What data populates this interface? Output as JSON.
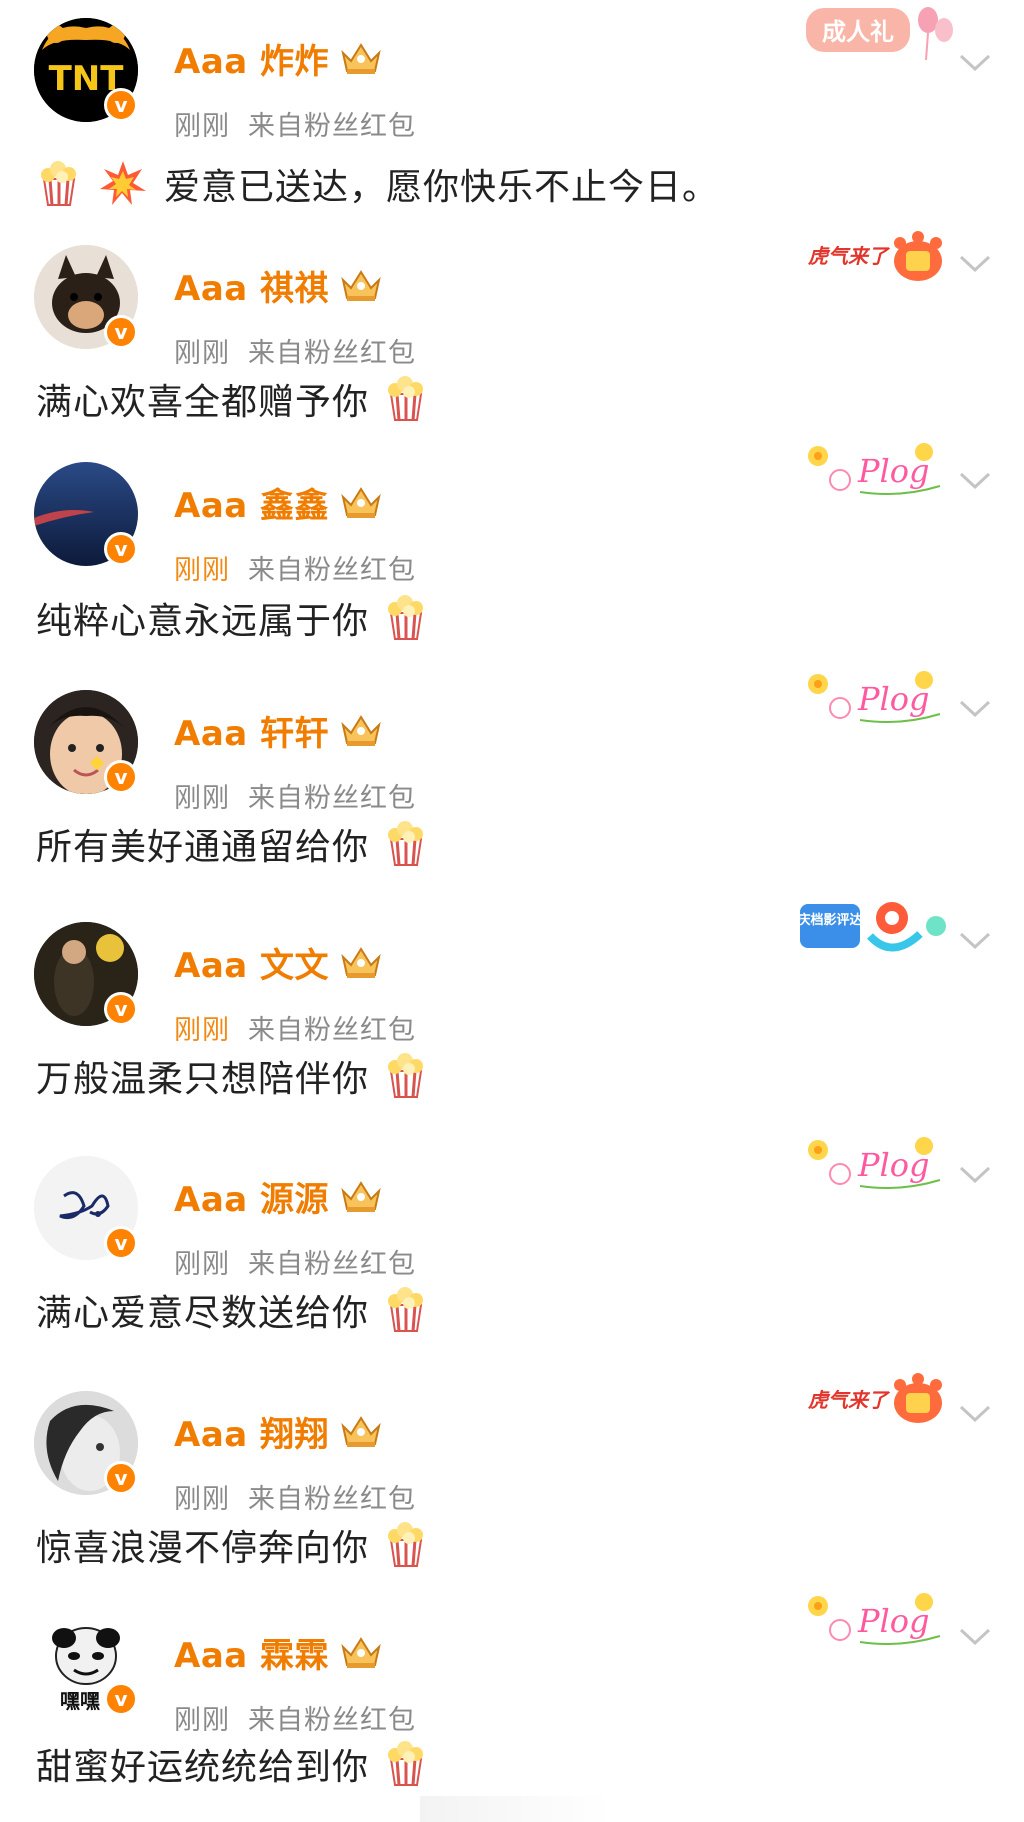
{
  "meta_sep": "来自粉丝红包",
  "posts": [
    {
      "name": "Aaa 炸炸",
      "time": "刚刚",
      "source": "来自粉丝红包",
      "content": "爱意已送达，愿你快乐不止今日。",
      "decor": "成人礼"
    },
    {
      "name": "Aaa 祺祺",
      "time": "刚刚",
      "source": "来自粉丝红包",
      "content": "满心欢喜全都赠予你",
      "decor": "虎气来了"
    },
    {
      "name": "Aaa 鑫鑫",
      "time": "刚刚",
      "source": "来自粉丝红包",
      "content": "纯粹心意永远属于你",
      "decor": "Plog"
    },
    {
      "name": "Aaa 轩轩",
      "time": "刚刚",
      "source": "来自粉丝红包",
      "content": "所有美好通通留给你",
      "decor": "Plog"
    },
    {
      "name": "Aaa 文文",
      "time": "刚刚",
      "source": "来自粉丝红包",
      "content": "万般温柔只想陪伴你",
      "decor": "国庆档影评达人"
    },
    {
      "name": "Aaa 源源",
      "time": "刚刚",
      "source": "来自粉丝红包",
      "content": "满心爱意尽数送给你",
      "decor": "Plog"
    },
    {
      "name": "Aaa 翔翔",
      "time": "刚刚",
      "source": "来自粉丝红包",
      "content": "惊喜浪漫不停奔向你",
      "decor": "虎气来了"
    },
    {
      "name": "Aaa 霖霖",
      "time": "刚刚",
      "source": "来自粉丝红包",
      "content": "甜蜜好运统统给到你",
      "decor": "Plog"
    }
  ],
  "avatar_texts": {
    "first": "TNT",
    "last": "嘿嘿"
  },
  "colors": {
    "username": "#f07d00",
    "meta": "#8a8a8a",
    "verified": "#ff8200"
  }
}
